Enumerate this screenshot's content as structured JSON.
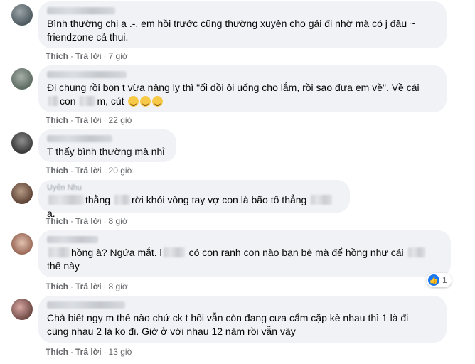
{
  "actions": {
    "like": "Thích",
    "reply": "Trả lời",
    "sep": "·"
  },
  "comments": [
    {
      "lines": [
        "Bình thường chị ạ .-. em hồi trước cũng thường xuyên cho gái đi nhờ mà có j đâu ~",
        "friendzone cả thui."
      ],
      "time": "7 giờ"
    },
    {
      "line1": "Đi chung rồi bọn t vừa nâng ly thì \"ối dồi ôi uống cho lắm, rồi sao đưa em về\". Về cái",
      "line2_a": "con",
      "line2_b": "m, cút",
      "time": "22 giờ"
    },
    {
      "line1": "T thấy bình thường mà nhỉ",
      "time": "20 giờ"
    },
    {
      "name_partial": "Uyên Nhu",
      "p1": "thằng",
      "p2": "rời khỏi vòng tay vợ con là bão tố thẳng",
      "p3": "ạ.",
      "time": "8 giờ"
    },
    {
      "l1a": "hồng à? Ngứa mắt. l",
      "l1b": "có con ranh con nào bạn bè mà để hồng như cái",
      "l2": "thế này",
      "reaction_count": "1",
      "time": "8 giờ"
    },
    {
      "lines": [
        "Chả biết ngy m thế nào chứ ck t hồi vẫn còn đang cưa cẩm cặp kè nhau thì 1 là đi",
        "cùng nhau 2 là ko đi. Giờ ở với nhau 12 năm rồi vẫn vậy"
      ],
      "time": "13 giờ"
    }
  ]
}
